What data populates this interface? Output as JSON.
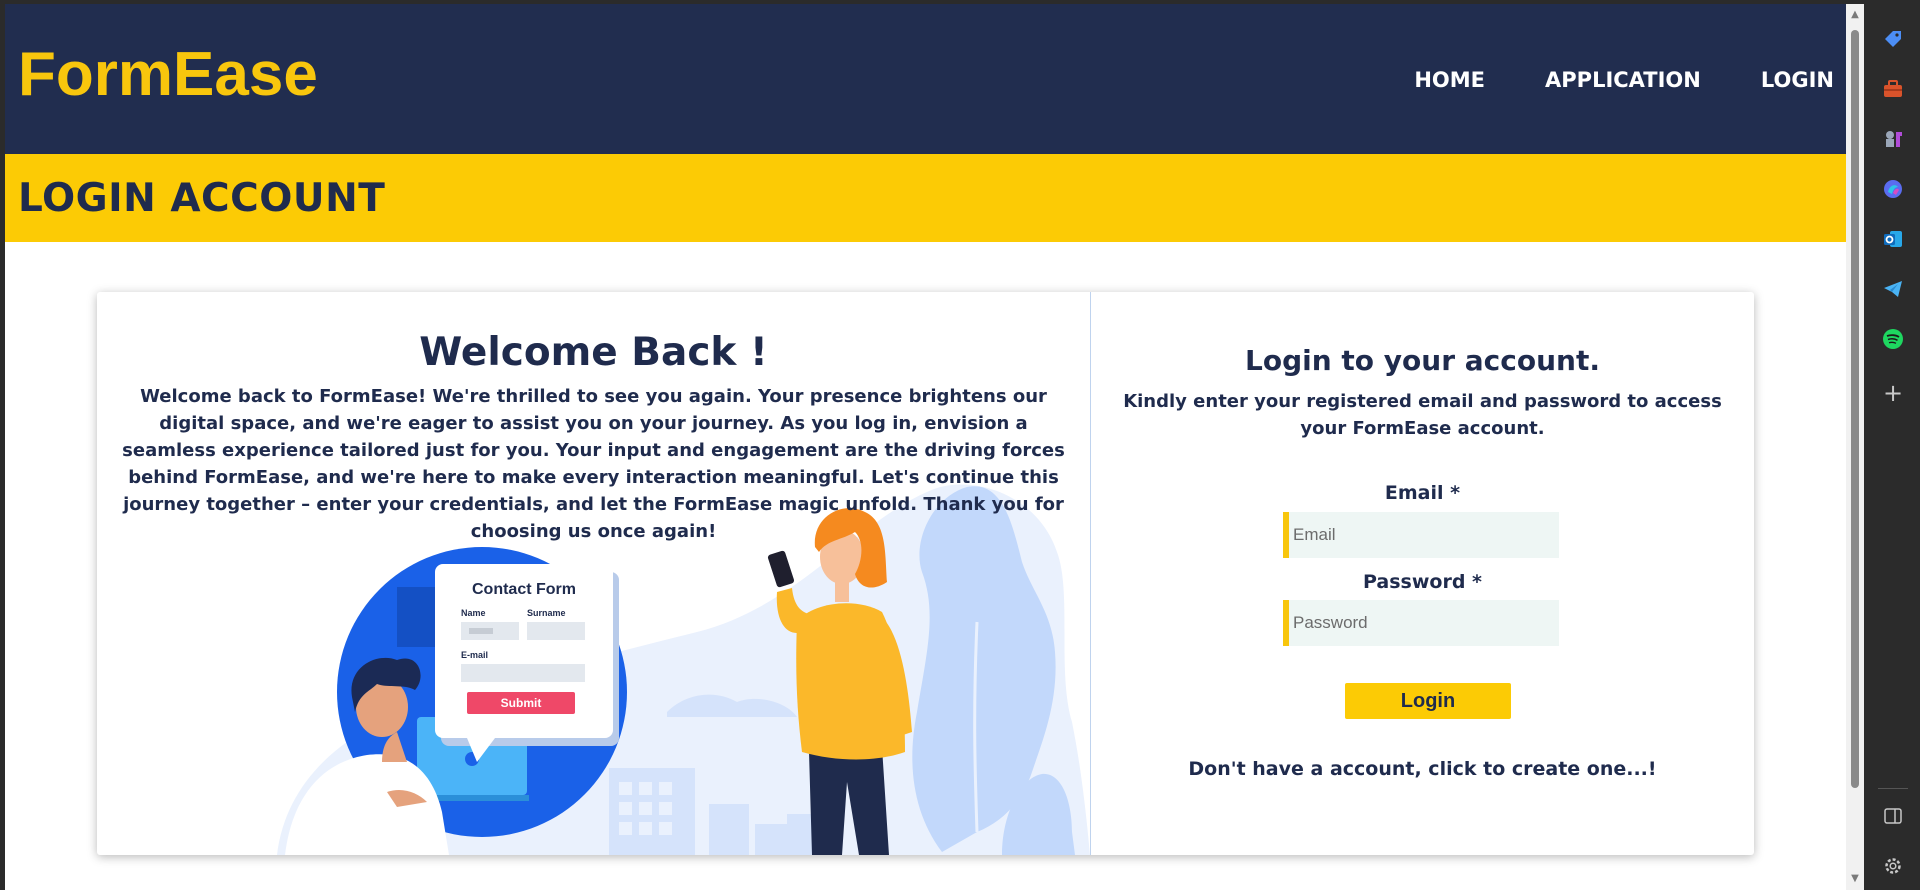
{
  "header": {
    "brand": "FormEase",
    "nav": [
      "HOME",
      "APPLICATION",
      "LOGIN"
    ]
  },
  "banner": {
    "title": "LOGIN ACCOUNT"
  },
  "welcome": {
    "title": "Welcome Back !",
    "body": "Welcome back to FormEase! We're thrilled to see you again. Your presence brightens our digital space, and we're eager to assist you on your journey. As you log in, envision a seamless experience tailored just for you. Your input and engagement are the driving forces behind FormEase, and we're here to make every interaction meaningful. Let's continue this journey together – enter your credentials, and let the FormEase magic unfold. Thank you for choosing us once again!"
  },
  "illustration": {
    "form_title": "Contact Form",
    "name_label": "Name",
    "surname_label": "Surname",
    "email_label": "E-mail",
    "submit_label": "Submit"
  },
  "login": {
    "title": "Login to your account.",
    "subtitle": "Kindly enter your registered email and password to access your FormEase account.",
    "email_label": "Email *",
    "email_placeholder": "Email",
    "password_label": "Password *",
    "password_placeholder": "Password",
    "button_label": "Login",
    "create_link": "Don't have a account, click to create one...!"
  },
  "sidebar_icons": [
    "tag-icon",
    "toolbox-icon",
    "chess-icon",
    "copilot-icon",
    "outlook-icon",
    "telegram-icon",
    "spotify-icon",
    "add-icon",
    "panel-icon",
    "settings-icon"
  ],
  "colors": {
    "navy": "#212d4f",
    "yellow": "#fccb05",
    "brand_yellow": "#f8c60d",
    "input_bg": "#eef6f4"
  }
}
